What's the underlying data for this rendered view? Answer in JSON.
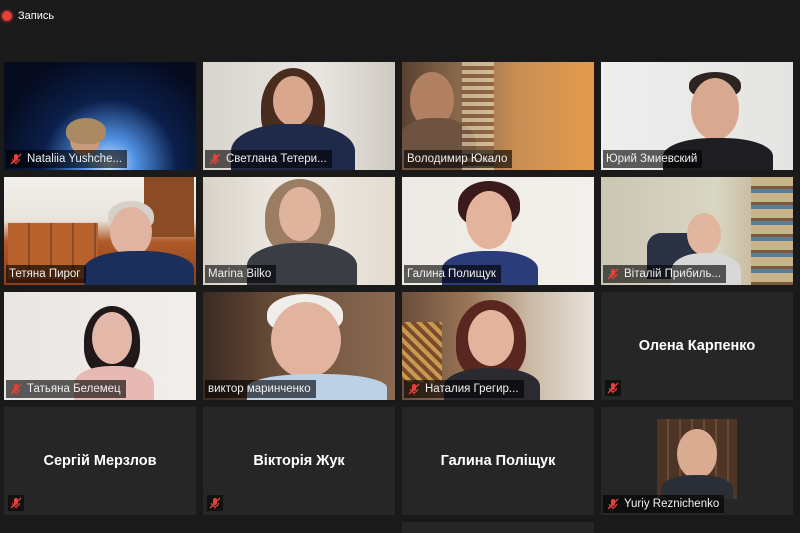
{
  "recording": {
    "label": "Запись",
    "color": "#e5403a"
  },
  "accent": {
    "active_speaker": "#c6e84a",
    "mic_muted": "#e5403a"
  },
  "participants": [
    {
      "name": "Nataliia Yushche...",
      "muted": true
    },
    {
      "name": "Светлана Тетери...",
      "muted": true
    },
    {
      "name": "Володимир Юкало",
      "muted": false
    },
    {
      "name": "Юрий Змиевский",
      "muted": false
    },
    {
      "name": "Тетяна Пирог",
      "muted": false,
      "active_speaker": true
    },
    {
      "name": "Marina Bilko",
      "muted": false
    },
    {
      "name": "Галина Полищук",
      "muted": false
    },
    {
      "name": "Віталій Прибиль...",
      "muted": true
    },
    {
      "name": "Татьяна Белемец",
      "muted": true
    },
    {
      "name": "виктор маринченко",
      "muted": false
    },
    {
      "name": "Наталия Грегир...",
      "muted": true
    },
    {
      "name": "Олена Карпенко",
      "muted": true,
      "video_off": true
    },
    {
      "name": "Сергій Мерзлов",
      "muted": true,
      "video_off": true
    },
    {
      "name": "Вікторія Жук",
      "muted": true,
      "video_off": true
    },
    {
      "name": "Галина Поліщук",
      "muted": false,
      "video_off": true
    },
    {
      "name": "Yuriy Reznichenko",
      "muted": true
    }
  ],
  "icons": {
    "mic_muted": "mic-off-icon",
    "recording": "record-dot-icon"
  }
}
